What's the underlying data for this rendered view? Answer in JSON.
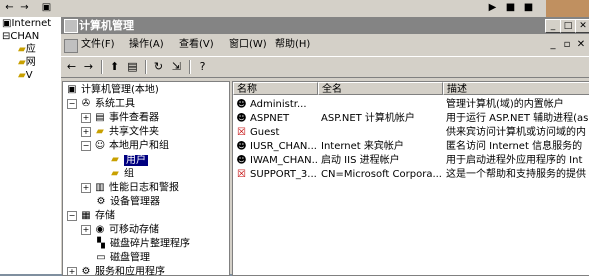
{
  "back_window": {
    "tree_items": [
      "Internet",
      "CHAN",
      "应",
      "网",
      "V"
    ]
  },
  "window": {
    "title": "计算机管理"
  },
  "menu": {
    "items": [
      "文件(F)",
      "操作(A)",
      "查看(V)",
      "窗口(W)",
      "帮助(H)"
    ]
  },
  "tree": {
    "root": "计算机管理(本地)",
    "system_tools": "系统工具",
    "event_viewer": "事件查看器",
    "shared_folders": "共享文件夹",
    "local_users_groups": "本地用户和组",
    "users": "用户",
    "groups": "组",
    "perf_logs": "性能日志和警报",
    "device_manager": "设备管理器",
    "storage": "存储",
    "removable_storage": "可移动存储",
    "defrag": "磁盘碎片整理程序",
    "disk_mgmt": "磁盘管理",
    "services_apps": "服务和应用程序"
  },
  "list": {
    "columns": [
      "名称",
      "全名",
      "描述"
    ],
    "rows": [
      {
        "name": "Administr...",
        "fullname": "",
        "desc": "管理计算机(域)的内置帐户",
        "disabled": false
      },
      {
        "name": "ASPNET",
        "fullname": "ASP.NET 计算机帐户",
        "desc": "用于运行 ASP.NET 辅助进程(as",
        "disabled": false
      },
      {
        "name": "Guest",
        "fullname": "",
        "desc": "供来宾访问计算机或访问域的内",
        "disabled": true
      },
      {
        "name": "IUSR_CHAN...",
        "fullname": "Internet 来宾帐户",
        "desc": "匿名访问 Internet 信息服务的",
        "disabled": false
      },
      {
        "name": "IWAM_CHAN...",
        "fullname": "启动 IIS 进程帐户",
        "desc": "用于启动进程外应用程序的 Int",
        "disabled": false
      },
      {
        "name": "SUPPORT_3...",
        "fullname": "CN=Microsoft Corpora...",
        "desc": "这是一个帮助和支持服务的提供",
        "disabled": true
      }
    ]
  }
}
